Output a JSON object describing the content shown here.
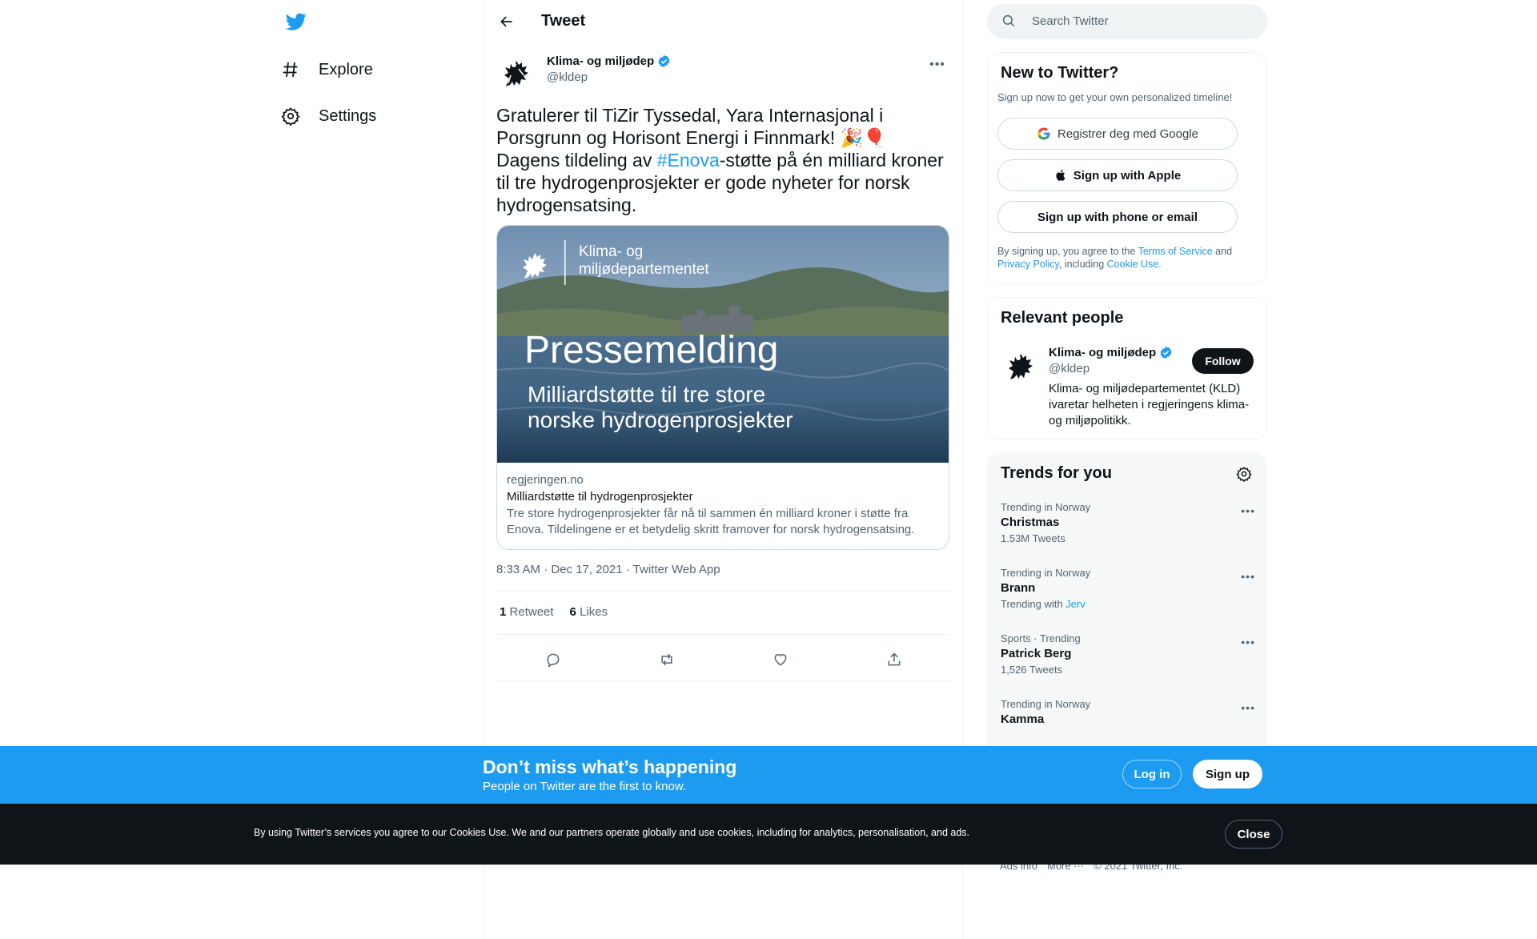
{
  "nav": {
    "items": [
      {
        "label": "Explore",
        "icon": "hashtag-icon"
      },
      {
        "label": "Settings",
        "icon": "gear-icon"
      }
    ]
  },
  "header": {
    "title": "Tweet"
  },
  "tweet": {
    "author_name": "Klima- og miljødep",
    "author_handle": "@kldep",
    "text_before": "Gratulerer til TiZir Tyssedal, Yara Internasjonal i Porsgrunn og Horisont Energi i Finnmark! 🎉🎈 Dagens tildeling av ",
    "hashtag": "#Enova",
    "text_after": "-støtte på én milliard kroner til tre hydrogenprosjekter er gode nyheter for norsk hydrogensatsing.",
    "card": {
      "image_org_line1": "Klima- og",
      "image_org_line2": "miljødepartementet",
      "image_headline": "Pressemelding",
      "image_sub_line1": "Milliardstøtte til tre store",
      "image_sub_line2": "norske hydrogenprosjekter",
      "domain": "regjeringen.no",
      "title": "Milliardstøtte til hydrogenprosjekter",
      "description": "Tre store hydrogenprosjekter får nå til sammen én milliard kroner i støtte fra Enova. Tildelingene er et betydelig skritt framover for norsk hydrogensatsing."
    },
    "timestamp": "8:33 AM · Dec 17, 2021 · Twitter Web App",
    "retweet_count": "1",
    "retweet_label": "Retweet",
    "like_count": "6",
    "like_label": "Likes"
  },
  "search": {
    "placeholder": "Search Twitter"
  },
  "new_to_twitter": {
    "title": "New to Twitter?",
    "subtitle": "Sign up now to get your own personalized timeline!",
    "google_label": "Registrer deg med Google",
    "apple_label": "Sign up with Apple",
    "phone_label": "Sign up with phone or email",
    "legal_prefix": "By signing up, you agree to the ",
    "terms": "Terms of Service",
    "and": " and ",
    "privacy": "Privacy Policy",
    "including": ", including ",
    "cookie": "Cookie Use."
  },
  "relevant_people": {
    "title": "Relevant people",
    "name": "Klima- og miljødep",
    "handle": "@kldep",
    "follow_label": "Follow",
    "bio": "Klima- og miljødepartementet (KLD) ivaretar helheten i regjeringens klima- og miljøpolitikk."
  },
  "trends": {
    "title": "Trends for you",
    "items": [
      {
        "context": "Trending in Norway",
        "name": "Christmas",
        "count": "1.53M Tweets"
      },
      {
        "context": "Trending in Norway",
        "name": "Brann",
        "count_prefix": "Trending with ",
        "count_link": "Jerv"
      },
      {
        "context": "Sports · Trending",
        "name": "Patrick Berg",
        "count": "1,526 Tweets"
      },
      {
        "context": "Trending in Norway",
        "name": "Kamma"
      }
    ]
  },
  "footer": {
    "links": [
      "Ads info",
      "More ···",
      "© 2021 Twitter, Inc."
    ]
  },
  "signup_bar": {
    "title": "Don’t miss what’s happening",
    "subtitle": "People on Twitter are the first to know.",
    "login_label": "Log in",
    "signup_label": "Sign up"
  },
  "cookie_bar": {
    "text": "By using Twitter’s services you agree to our Cookies Use. We and our partners operate globally and use cookies, including for analytics, personalisation, and ads.",
    "close_label": "Close"
  },
  "colors": {
    "accent": "#1d9bf0",
    "text": "#0f1419",
    "muted": "#536471",
    "dark_bar": "#0f1419"
  }
}
